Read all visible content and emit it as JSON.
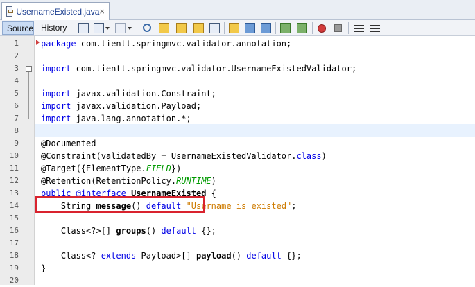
{
  "tab": {
    "title": "UsernameExisted.java",
    "close": "×"
  },
  "tabbar": {
    "nav_left": "◂",
    "nav_right": "▸"
  },
  "toolbar": {
    "source_label": "Source",
    "history_label": "History"
  },
  "colors": {
    "keyword": "#0000e6",
    "string": "#ce7b00",
    "enum_constant": "#009900",
    "highlight_box": "#d9232e",
    "current_line": "#e8f2fe"
  },
  "icons": [
    "last-edit-icon",
    "back-icon",
    "forward-icon",
    "find-icon",
    "find-previous-icon",
    "find-next-icon",
    "toggle-highlight-icon",
    "toggle-rect-select-icon",
    "previous-bookmark-icon",
    "next-bookmark-icon",
    "toggle-bookmark-icon",
    "shift-left-icon",
    "shift-right-icon",
    "record-macro-icon",
    "stop-macro-icon",
    "comment-icon",
    "uncomment-icon"
  ],
  "editor": {
    "current_line": 8,
    "highlighted_line": 11,
    "lines": [
      {
        "n": "1",
        "segs": [
          {
            "t": "package",
            "c": "kw"
          },
          {
            "t": " com.tientt.springmvc.validator.annotation;",
            "c": ""
          }
        ]
      },
      {
        "n": "2",
        "segs": []
      },
      {
        "n": "3",
        "segs": [
          {
            "t": "import",
            "c": "kw"
          },
          {
            "t": " com.tientt.springmvc.validator.UsernameExistedValidator;",
            "c": ""
          }
        ]
      },
      {
        "n": "4",
        "segs": []
      },
      {
        "n": "5",
        "segs": [
          {
            "t": "import",
            "c": "kw"
          },
          {
            "t": " javax.validation.Constraint;",
            "c": ""
          }
        ]
      },
      {
        "n": "6",
        "segs": [
          {
            "t": "import",
            "c": "kw"
          },
          {
            "t": " javax.validation.Payload;",
            "c": ""
          }
        ]
      },
      {
        "n": "7",
        "segs": [
          {
            "t": "import",
            "c": "kw"
          },
          {
            "t": " java.lang.annotation.*;",
            "c": ""
          }
        ]
      },
      {
        "n": "8",
        "segs": []
      },
      {
        "n": "9",
        "segs": [
          {
            "t": "@Documented",
            "c": ""
          }
        ]
      },
      {
        "n": "10",
        "segs": [
          {
            "t": "@Constraint(validatedBy = UsernameExistedValidator.",
            "c": ""
          },
          {
            "t": "class",
            "c": "kw"
          },
          {
            "t": ")",
            "c": ""
          }
        ]
      },
      {
        "n": "11",
        "segs": [
          {
            "t": "@Target({ElementType.",
            "c": ""
          },
          {
            "t": "FIELD",
            "c": "it"
          },
          {
            "t": "})",
            "c": ""
          }
        ]
      },
      {
        "n": "12",
        "segs": [
          {
            "t": "@Retention(RetentionPolicy.",
            "c": ""
          },
          {
            "t": "RUNTIME",
            "c": "it"
          },
          {
            "t": ")",
            "c": ""
          }
        ]
      },
      {
        "n": "13",
        "segs": [
          {
            "t": "public",
            "c": "kw"
          },
          {
            "t": " ",
            "c": ""
          },
          {
            "t": "@interface",
            "c": "kw"
          },
          {
            "t": " ",
            "c": ""
          },
          {
            "t": "UsernameExisted",
            "c": "bd"
          },
          {
            "t": " {",
            "c": ""
          }
        ]
      },
      {
        "n": "14",
        "segs": [
          {
            "t": "    String ",
            "c": ""
          },
          {
            "t": "message",
            "c": "bd"
          },
          {
            "t": "() ",
            "c": ""
          },
          {
            "t": "default",
            "c": "kw"
          },
          {
            "t": " ",
            "c": ""
          },
          {
            "t": "\"Username is existed\"",
            "c": "str"
          },
          {
            "t": ";",
            "c": ""
          }
        ]
      },
      {
        "n": "15",
        "segs": []
      },
      {
        "n": "16",
        "segs": [
          {
            "t": "    Class<?>[] ",
            "c": ""
          },
          {
            "t": "groups",
            "c": "bd"
          },
          {
            "t": "() ",
            "c": ""
          },
          {
            "t": "default",
            "c": "kw"
          },
          {
            "t": " {};",
            "c": ""
          }
        ]
      },
      {
        "n": "17",
        "segs": []
      },
      {
        "n": "18",
        "segs": [
          {
            "t": "    Class<? ",
            "c": ""
          },
          {
            "t": "extends",
            "c": "kw"
          },
          {
            "t": " Payload>[] ",
            "c": ""
          },
          {
            "t": "payload",
            "c": "bd"
          },
          {
            "t": "() ",
            "c": ""
          },
          {
            "t": "default",
            "c": "kw"
          },
          {
            "t": " {};",
            "c": ""
          }
        ]
      },
      {
        "n": "19",
        "segs": [
          {
            "t": "}",
            "c": ""
          }
        ]
      },
      {
        "n": "20",
        "segs": []
      }
    ]
  }
}
